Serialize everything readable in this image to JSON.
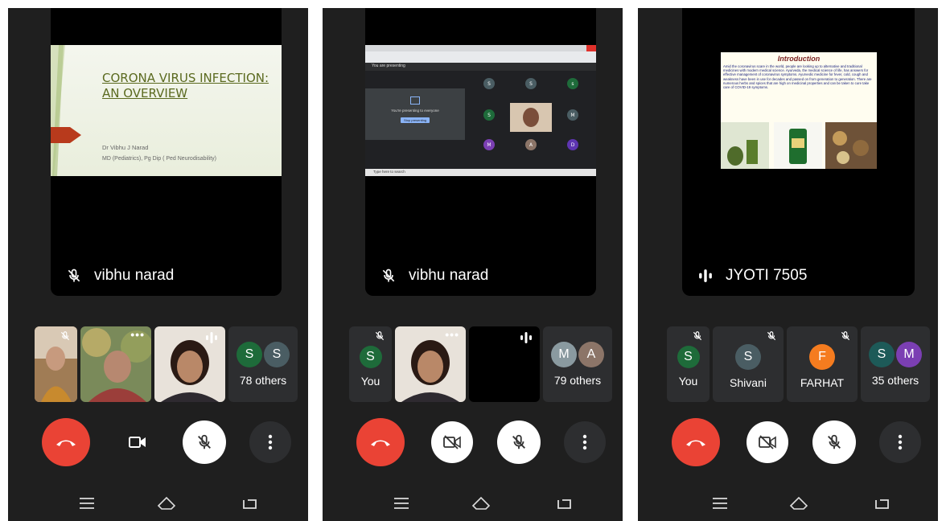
{
  "screens": [
    {
      "presenter": "vibhu narad",
      "slide": {
        "title_line1": "CORONA VIRUS INFECTION:",
        "title_line2": "AN OVERVIEW",
        "author": "Dr Vibhu J Narad",
        "degree": "MD (Pediatrics), Pg Dip ( Ped Neurodisability)"
      },
      "tiles": {
        "others_label": "78 others",
        "others_avatars": [
          "S",
          "S"
        ]
      }
    },
    {
      "presenter": "vibhu narad",
      "shared_screen": {
        "presenting_banner": "You are presenting",
        "presenting_message": "You're presenting to everyone",
        "stop_button": "Stop presenting",
        "taskbar_search": "Type here to search",
        "grid_avatars": [
          "S",
          "S",
          "s",
          "S",
          "M",
          "M",
          "A",
          "D"
        ]
      },
      "tiles": {
        "you_label": "You",
        "you_avatar": "S",
        "others_label": "79 others",
        "others_avatars": [
          "M",
          "A"
        ]
      }
    },
    {
      "presenter": "JYOTI 7505",
      "slide": {
        "title": "Introduction",
        "body": "Amid the coronavirus scare in the world, people are looking up to alternative and traditional medicines with modern medical science. Ayurveda, the medical science of life, has answers for effective management of coronavirus symptoms. Ayurvedic medicine for fever, cold, cough and weakness have been in use for decades and passed on from generation to generation. There are numerous herbs and spices that are high on medicinal properties and can be taken to cure take care of COVID-19 symptoms."
      },
      "tiles": {
        "you_label": "You",
        "you_avatar": "S",
        "p2_label": "Shivani",
        "p2_avatar": "S",
        "p3_label": "FARHAT",
        "p3_avatar": "F",
        "others_label": "35 others",
        "others_avatars": [
          "S",
          "M"
        ]
      }
    }
  ],
  "colors": {
    "end_call": "#ea4335",
    "screen_bg": "#1f1f1f",
    "tile_bg": "#2d2e30",
    "avatar_green": "#1e6b3a",
    "avatar_slate": "#4a5d63",
    "avatar_orange": "#f57c1f",
    "avatar_purple": "#7b3fb3",
    "avatar_teal": "#1d5a58",
    "avatar_taupe": "#8c7568"
  },
  "icons": [
    "mic-off-icon",
    "speaking-icon",
    "end-call-icon",
    "camera-icon",
    "camera-off-icon",
    "more-vert-icon",
    "menu-icon",
    "home-icon",
    "back-icon",
    "more-horiz-icon"
  ]
}
